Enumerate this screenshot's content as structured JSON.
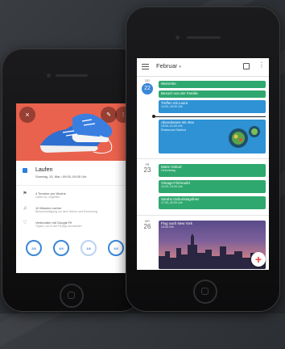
{
  "colors": {
    "hero": "#e8624d",
    "event_green": "#2fa86f",
    "event_blue": "#2e92d4",
    "accent_blue": "#3a86d8",
    "fab": "#ffffff"
  },
  "left_app": {
    "title": "Laufen",
    "subtitle": "Sonntag, 15. Mai  •  09:00–09:30 Uhr",
    "rows": [
      {
        "icon": "flag-icon",
        "main": "4 Termine pro Woche",
        "sub": "Lieber so, ungefähr"
      },
      {
        "icon": "bell-icon",
        "main": "10 Minuten vorher",
        "sub": "Benachrichtigung vor dem Termin und Erinnerung"
      },
      {
        "icon": "heart-icon",
        "main": "Verbunden mit Google Fit",
        "sub": "Tippen, um in der Fit-App anzusehen"
      }
    ],
    "progress": [
      "2/4",
      "4/4",
      "1/4",
      "2/4"
    ]
  },
  "right_app": {
    "month": "Februar",
    "days": [
      {
        "weekday": "DO",
        "number": "22"
      },
      {
        "weekday": "FR",
        "number": "23"
      },
      {
        "weekday": "MO",
        "number": "26"
      }
    ],
    "events": [
      {
        "title": "Weinrebe",
        "sub": ""
      },
      {
        "title": "Besuch von der Familie",
        "sub": ""
      },
      {
        "title": "Treffen mit Laura",
        "sub": "14:00–15:00 Uhr"
      },
      {
        "title": "Abendessen mit Alex",
        "sub": "19:00–21:00 Uhr",
        "sub2": "Restaurant Stalbrot"
      },
      {
        "title": "Marie Geburt",
        "sub": "Geburtstag"
      },
      {
        "title": "Vintage-Flohmarkt",
        "sub": "10:00–13:00 Uhr"
      },
      {
        "title": "Sarahs Geburtstagsfeier",
        "sub": "17:00–20:00 Uhr"
      },
      {
        "title": "Flug nach New York",
        "sub": "14:00 Uhr"
      }
    ]
  }
}
